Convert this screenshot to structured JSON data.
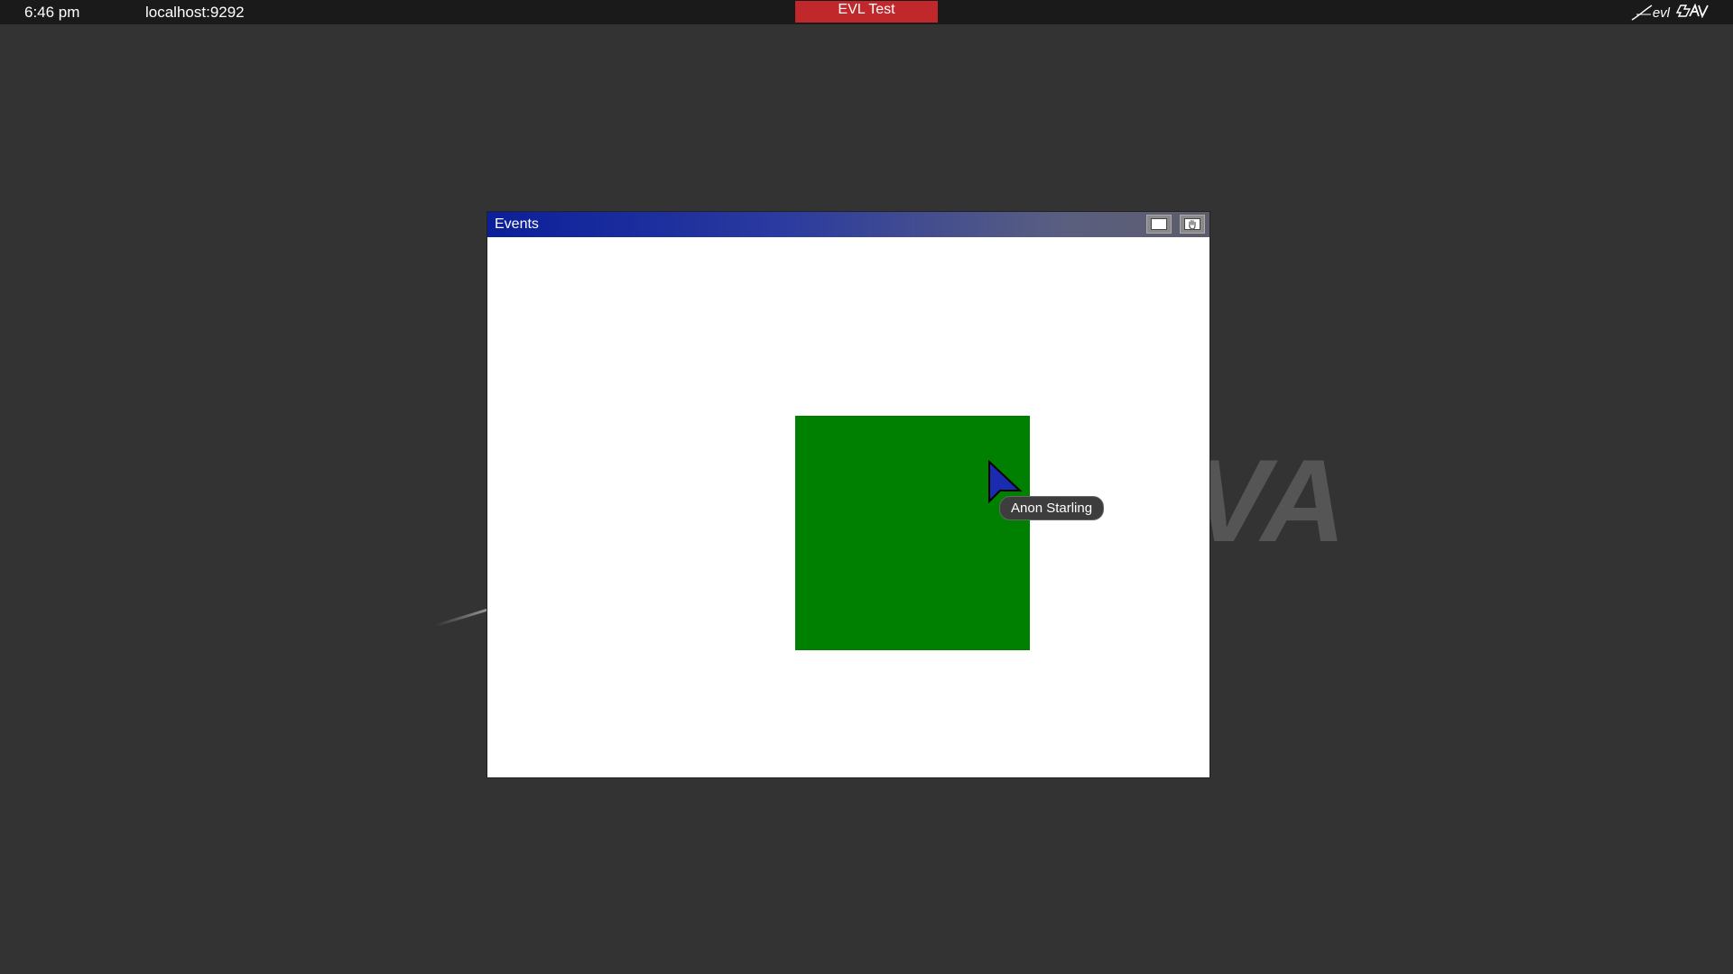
{
  "topbar": {
    "clock": "6:46 pm",
    "host": "localhost:9292",
    "session_name": "EVL Test",
    "session_color": "#c0282c",
    "logo_evl": "evl",
    "logo_sage": "SAGE"
  },
  "background": {
    "color": "#333333",
    "watermark_icon": "sage-watermark-icon"
  },
  "window": {
    "title": "Events",
    "maximize_icon": "maximize-icon",
    "close_icon": "close-hand-icon",
    "content": {
      "square_color": "#008000"
    }
  },
  "pointer": {
    "icon": "arrow-cursor-icon",
    "color": "#1a2bb0",
    "user_name": "Anon Starling"
  }
}
